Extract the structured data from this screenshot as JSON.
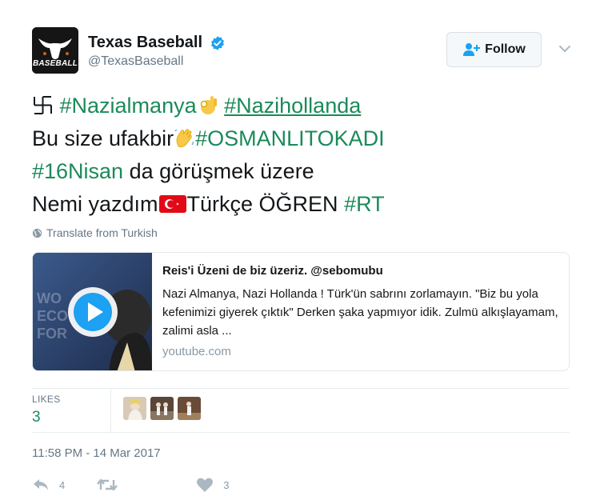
{
  "user": {
    "display_name": "Texas Baseball",
    "handle": "@TexasBaseball",
    "avatar_text": "BASEBALL",
    "verified": true
  },
  "follow_button": {
    "label": "Follow"
  },
  "tweet": {
    "line1": {
      "hashtag1": "#Nazialmanya",
      "hashtag2": "#Nazihollanda"
    },
    "line2": {
      "text": "Bu size ufakbir",
      "hashtag": "#OSMANLITOKADI"
    },
    "line3": {
      "hashtag": "#16Nisan",
      "text": " da görüşmek üzere"
    },
    "line4": {
      "text1": "Nemi yazdım",
      "text2": "Türkçe ÖĞREN ",
      "hashtag": "#RT"
    }
  },
  "translate_label": "Translate from Turkish",
  "card": {
    "title": "Reis'i Üzeni de biz üzeriz. @sebomubu",
    "description": "Nazi Almanya, Nazi Hollanda ! Türk'ün sabrını zorlamayın. \"Biz bu yola kefenimizi giyerek çıktık\" Derken şaka yapmıyor idik. Zulmü alkışlayamam, zalimi asla ...",
    "domain": "youtube.com",
    "thumb_text": "WO\nECO\nFOR"
  },
  "likes": {
    "label": "LIKES",
    "count": "3"
  },
  "timestamp": "11:58 PM - 14 Mar 2017",
  "actions": {
    "reply_count": "4",
    "retweet_count": "",
    "like_count": "3"
  },
  "colors": {
    "hashtag": "#1b8a5a",
    "muted": "#657786",
    "verified": "#1da1f2"
  },
  "icons": [
    "swastika-icon",
    "ok-hand-emoji",
    "waving-hand-emoji",
    "turkey-flag-emoji",
    "globe-icon",
    "play-icon",
    "reply-icon",
    "retweet-icon",
    "heart-icon",
    "verified-badge-icon",
    "add-user-icon",
    "chevron-down-icon"
  ]
}
